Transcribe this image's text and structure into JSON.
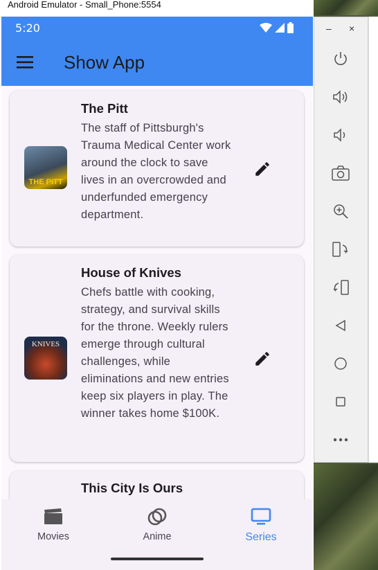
{
  "window": {
    "title": "Android Emulator - Small_Phone:5554"
  },
  "status_bar": {
    "time": "5:20"
  },
  "app_bar": {
    "title": "Show App",
    "menu_icon": "menu-icon"
  },
  "shows": [
    {
      "title": "The Pitt",
      "description": "The staff of Pittsburgh's Trauma Medical Center work around the clock to save lives in an overcrowded and underfunded emergency department.",
      "thumb_text": "THE PITT"
    },
    {
      "title": "House of Knives",
      "description": "Chefs battle with cooking, strategy, and survival skills for the throne. Weekly rulers emerge through cultural challenges, while eliminations and new entries keep six players in play. The winner takes home $100K.",
      "thumb_text": "KNIVES"
    },
    {
      "title": "This City Is Ours",
      "description": ""
    }
  ],
  "bottom_nav": {
    "items": [
      {
        "label": "Movies",
        "icon": "movie-icon"
      },
      {
        "label": "Anime",
        "icon": "anime-icon"
      },
      {
        "label": "Series",
        "icon": "tv-icon"
      }
    ],
    "active": "Series",
    "active_color": "#3f88f2"
  },
  "emulator_controls": {
    "minimize": "–",
    "close": "×",
    "buttons": [
      "power-icon",
      "volume-up-icon",
      "volume-down-icon",
      "camera-icon",
      "zoom-icon",
      "rotate-left-icon",
      "rotate-right-icon",
      "back-icon",
      "home-icon",
      "overview-icon",
      "more-icon"
    ]
  },
  "colors": {
    "app_bar": "#3f88f2",
    "background": "#fbf7fd",
    "card": "#f5eff7"
  }
}
